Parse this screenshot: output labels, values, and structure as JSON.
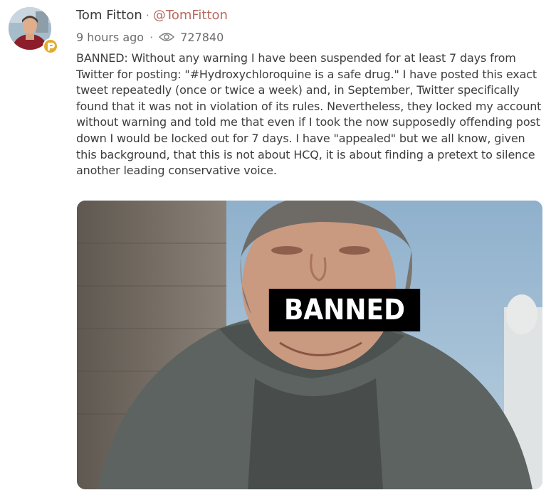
{
  "author": {
    "name": "Tom Fitton",
    "separator": "·",
    "handle": "@TomFitton",
    "avatar_icon": "user-avatar",
    "badge_icon": "parler-badge-icon"
  },
  "meta": {
    "time": "9 hours ago",
    "separator": "·",
    "views_icon": "eye-icon",
    "views": "727840"
  },
  "post": {
    "text": "BANNED: Without any warning I have been suspended for at least 7 days from Twitter for posting: \"#Hydroxychloroquine is a safe drug.\" I have posted this exact tweet repeatedly (once or twice a week) and, in September, Twitter specifically found that it was not in violation of its rules. Nevertheless, they locked my account without warning and told me that even if I took the now supposedly offending post down I would be locked out for 7 days. I have \"appealed\" but we all know, given this background, that this is not about HCQ, it is about finding a pretext to silence another leading conservative voice."
  },
  "media": {
    "overlay_text": "BANNED"
  },
  "colors": {
    "handle": "#b86a60",
    "badge": "#e2ac2f",
    "text": "#3d3d3d"
  }
}
